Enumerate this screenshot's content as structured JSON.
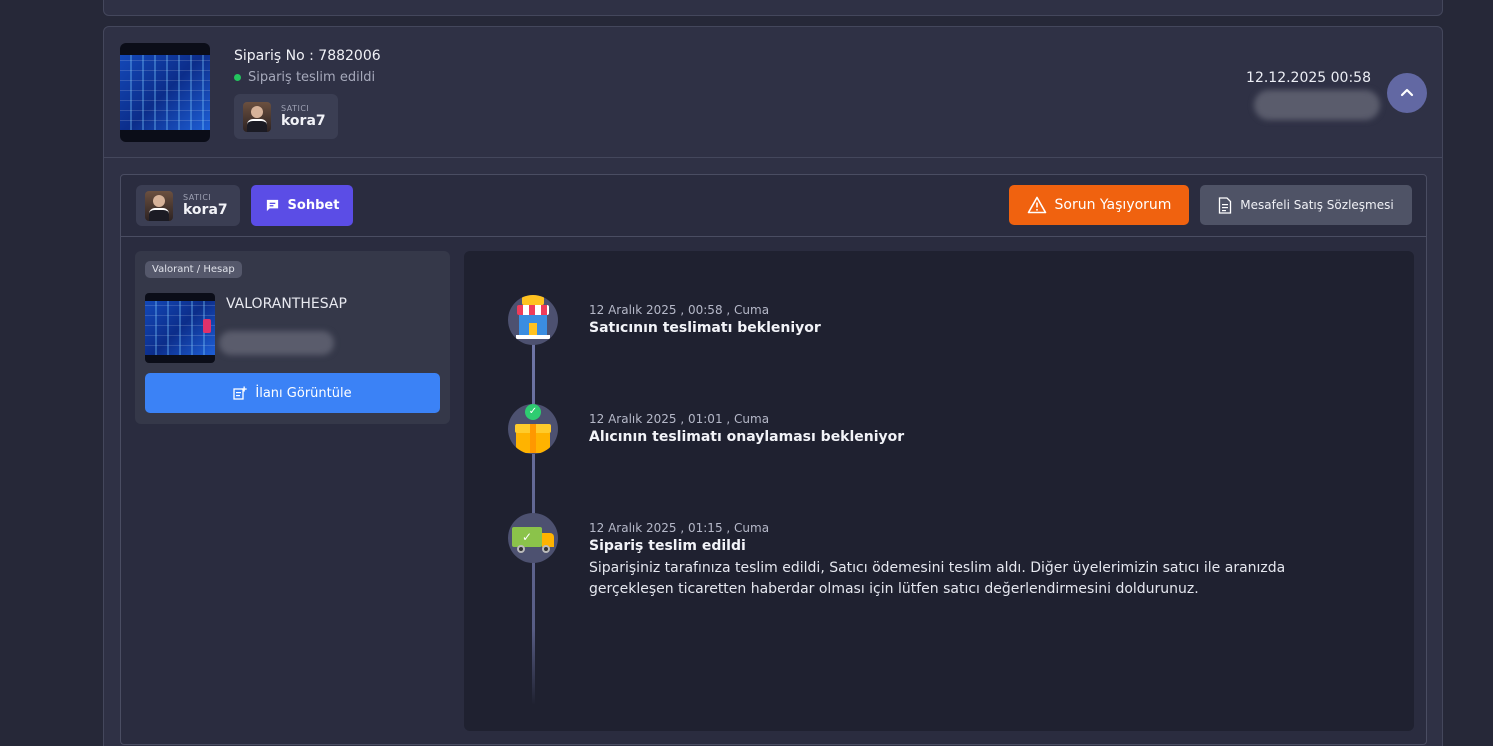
{
  "order": {
    "number_label": "Sipariş No : 7882006",
    "status": "Sipariş teslim edildi",
    "status_color": "#23c55e",
    "date": "12.12.2025 00:58",
    "seller_label": "SATICI",
    "seller_name": "kora7"
  },
  "toolbar": {
    "seller_label": "SATICI",
    "seller_name": "kora7",
    "chat_label": "Sohbet",
    "problem_label": "Sorun Yaşıyorum",
    "contract_label": "Mesafeli Satış Sözleşmesi"
  },
  "product": {
    "tag": "Valorant / Hesap",
    "title": "VALORANTHESAP",
    "view_label": "İlanı Görüntüle"
  },
  "timeline": [
    {
      "date": "12 Aralık 2025 , 00:58 , Cuma",
      "title": "Satıcının teslimatı bekleniyor",
      "icon": "store-icon"
    },
    {
      "date": "12 Aralık 2025 , 01:01 , Cuma",
      "title": "Alıcının teslimatı onaylaması bekleniyor",
      "icon": "package-check-icon"
    },
    {
      "date": "12 Aralık 2025 , 01:15 , Cuma",
      "title": "Sipariş teslim edildi",
      "icon": "delivery-truck-icon",
      "description": "Siparişiniz tarafınıza teslim edildi, Satıcı ödemesini teslim aldı. Diğer üyelerimizin satıcı ile aranızda gerçekleşen ticaretten haberdar olması için lütfen satıcı değerlendirmesini doldurunuz."
    }
  ],
  "colors": {
    "chat_button": "#5b4de6",
    "problem_button": "#f0620f",
    "view_button": "#3b82f6",
    "collapse_button": "#6268a3"
  }
}
